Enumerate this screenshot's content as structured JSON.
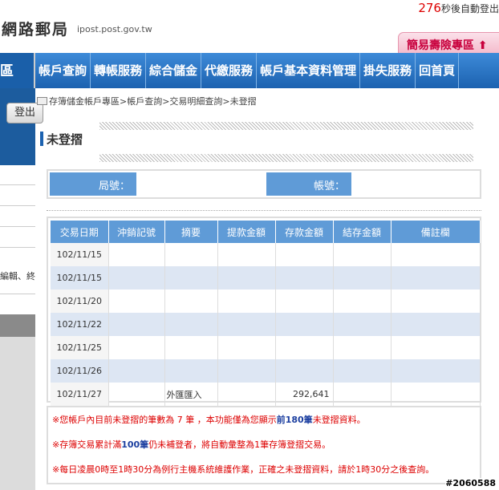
{
  "header": {
    "logo_text": "網路郵局",
    "logo_url": "ipost.post.gov.tw",
    "timer_num": "276",
    "timer_text": "秒後自動登出",
    "insurance_button": "簡易壽險專區 ⬆"
  },
  "nav": {
    "left_label": "區",
    "items": [
      "帳戶查詢",
      "轉帳服務",
      "綜合儲金",
      "代繳服務",
      "帳戶基本資料管理",
      "掛失服務",
      "回首頁"
    ]
  },
  "sidebar": {
    "logout_label": "登出",
    "truncated_text": "編輯、終"
  },
  "breadcrumb": "存簿儲金帳戶專區>帳戶查詢>交易明細查詢>未登摺",
  "page_title": "未登摺",
  "account": {
    "branch_label": "局號：",
    "branch_value": "",
    "account_label": "帳號：",
    "account_value": ""
  },
  "table": {
    "headers": [
      "交易日期",
      "沖銷記號",
      "摘要",
      "提款金額",
      "存款金額",
      "結存金額",
      "備註欄"
    ],
    "rows": [
      [
        "102/11/15",
        "",
        "",
        "",
        "",
        "",
        ""
      ],
      [
        "102/11/15",
        "",
        "",
        "",
        "",
        "",
        ""
      ],
      [
        "102/11/20",
        "",
        "",
        "",
        "",
        "",
        ""
      ],
      [
        "102/11/22",
        "",
        "",
        "",
        "",
        "",
        ""
      ],
      [
        "102/11/25",
        "",
        "",
        "",
        "",
        "",
        ""
      ],
      [
        "102/11/26",
        "",
        "",
        "",
        "",
        "",
        ""
      ],
      [
        "102/11/27",
        "",
        "外匯匯入",
        "",
        "292,641",
        "",
        ""
      ]
    ]
  },
  "notes": {
    "n1_a": "※您帳戶內目前未登摺的筆數為 7 筆 ，本功能僅為您顯示",
    "n1_b": "前180筆",
    "n1_c": "未登摺資料。",
    "n2_a": "※存簿交易累計滿",
    "n2_b": "100筆",
    "n2_c": "仍未補登者，將自動彙整為1筆存簿登摺交易。",
    "n3": "※每日凌晨0時至1時30分為例行主機系統維護作業，正確之未登摺資料，請於1時30分之後查詢。"
  },
  "watermark": "#2060588"
}
